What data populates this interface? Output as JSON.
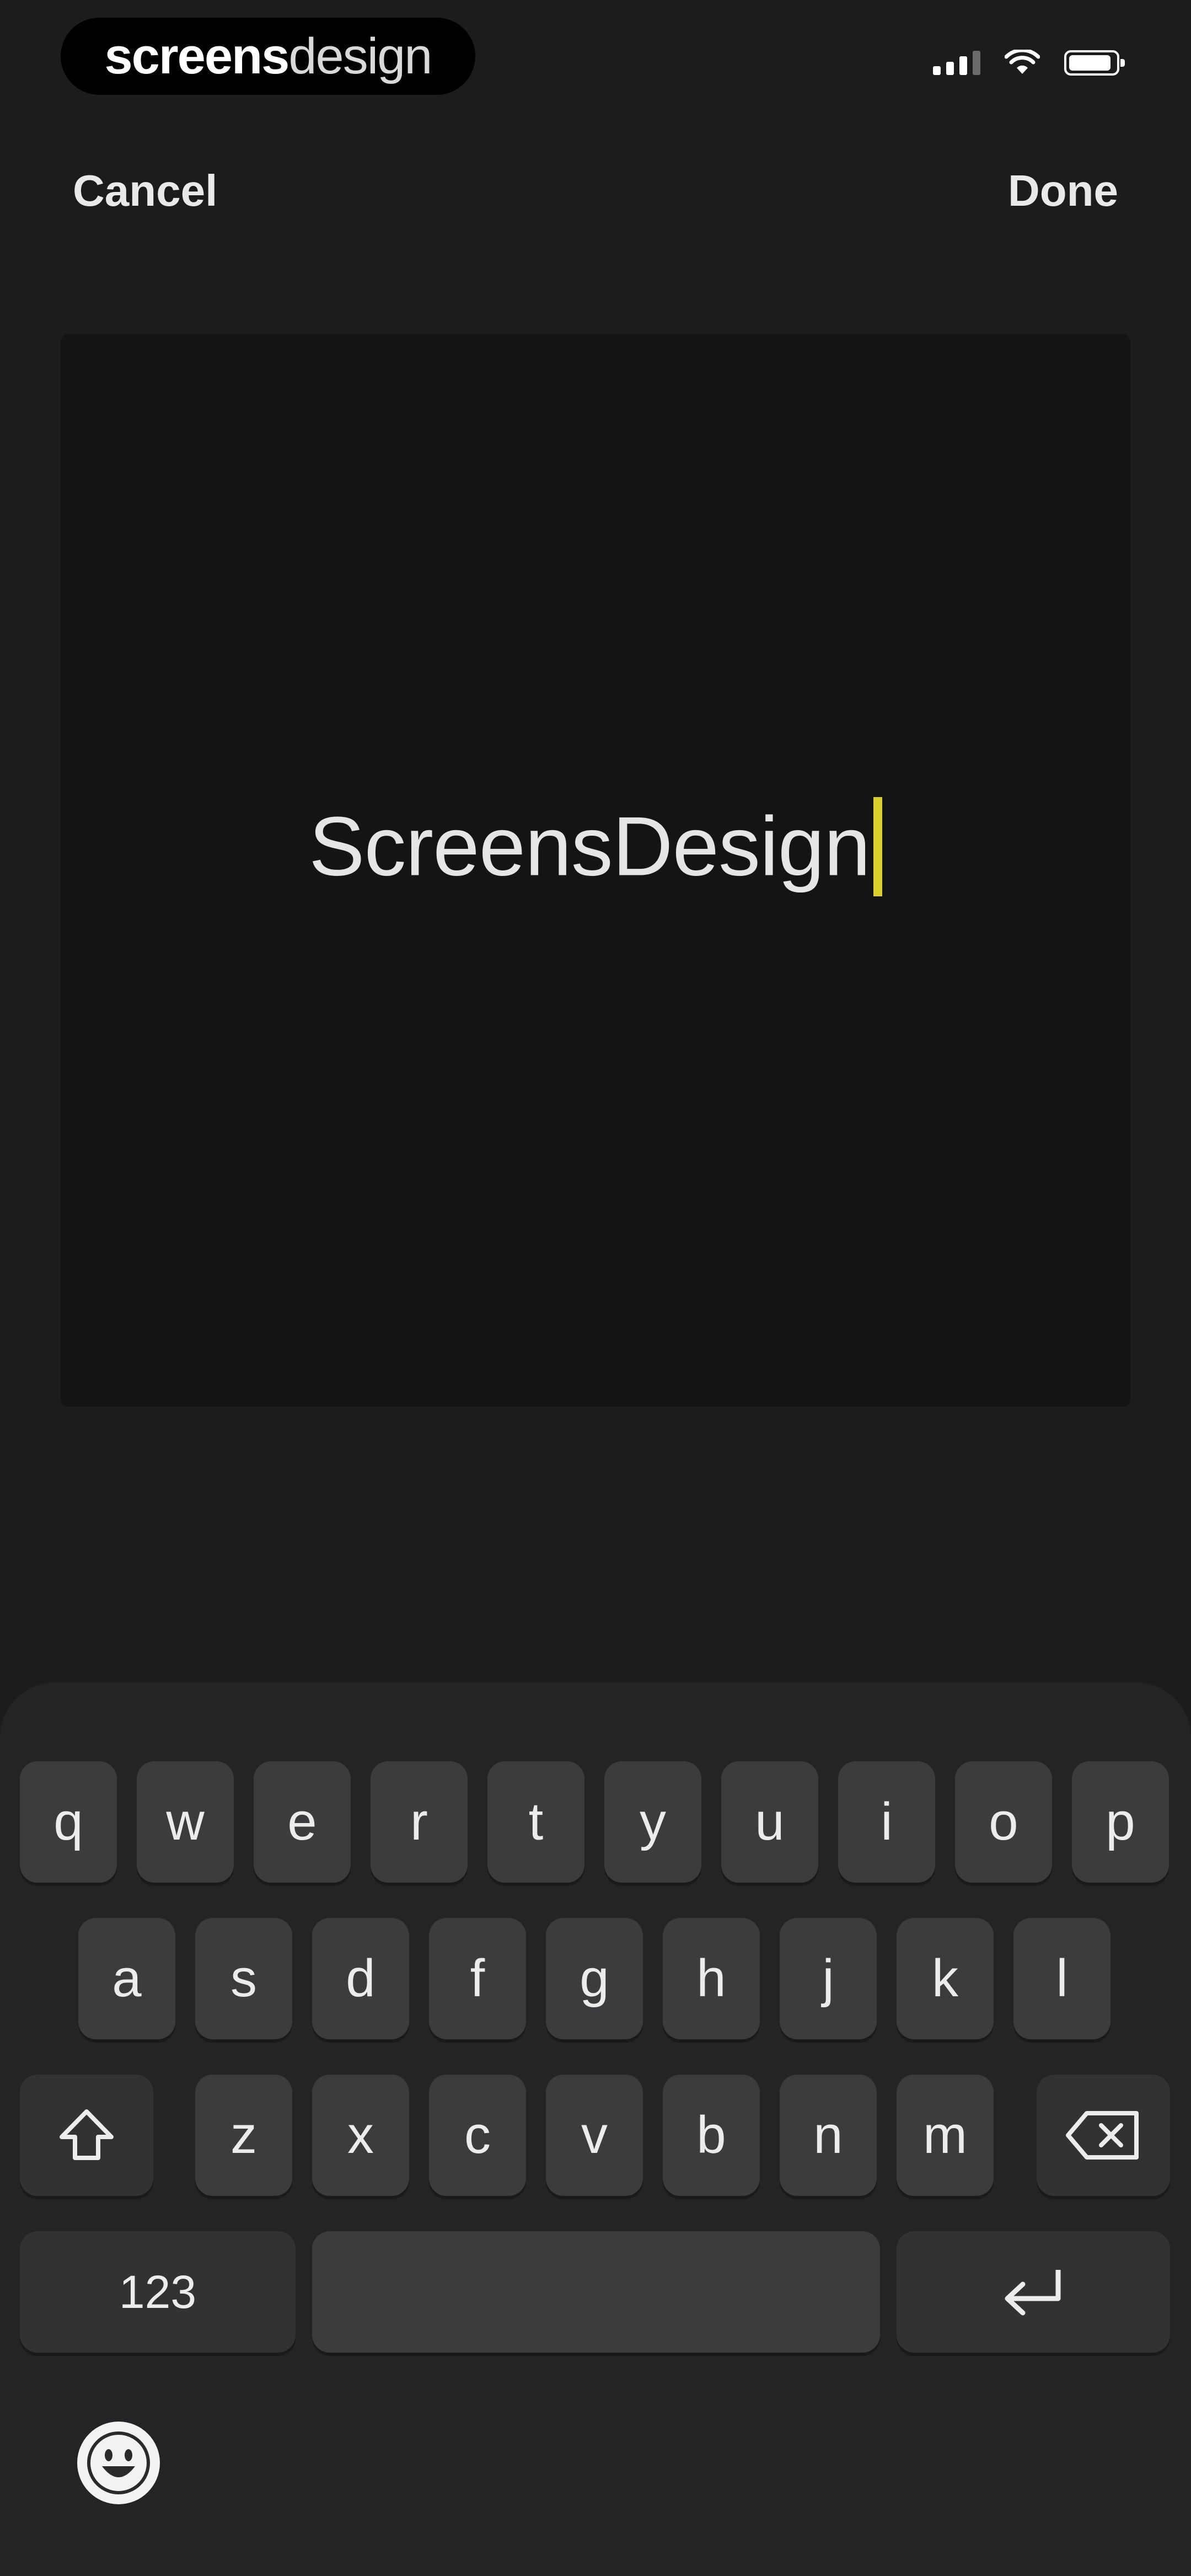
{
  "status_bar": {
    "brand_bold": "screens",
    "brand_light": "design"
  },
  "nav": {
    "cancel_label": "Cancel",
    "done_label": "Done"
  },
  "editor": {
    "text_value": "ScreensDesign"
  },
  "keyboard": {
    "row1": [
      "q",
      "w",
      "e",
      "r",
      "t",
      "y",
      "u",
      "i",
      "o",
      "p"
    ],
    "row2": [
      "a",
      "s",
      "d",
      "f",
      "g",
      "h",
      "j",
      "k",
      "l"
    ],
    "row3": [
      "z",
      "x",
      "c",
      "v",
      "b",
      "n",
      "m"
    ],
    "numbers_key_label": "123",
    "space_label": "",
    "icons": {
      "shift": "shift-icon",
      "delete": "delete-icon",
      "return": "return-icon",
      "emoji": "emoji-icon"
    }
  },
  "colors": {
    "background": "#1c1c1e",
    "canvas": "#141414",
    "caret": "#d9cf2a",
    "key": "#3c3c3e"
  }
}
